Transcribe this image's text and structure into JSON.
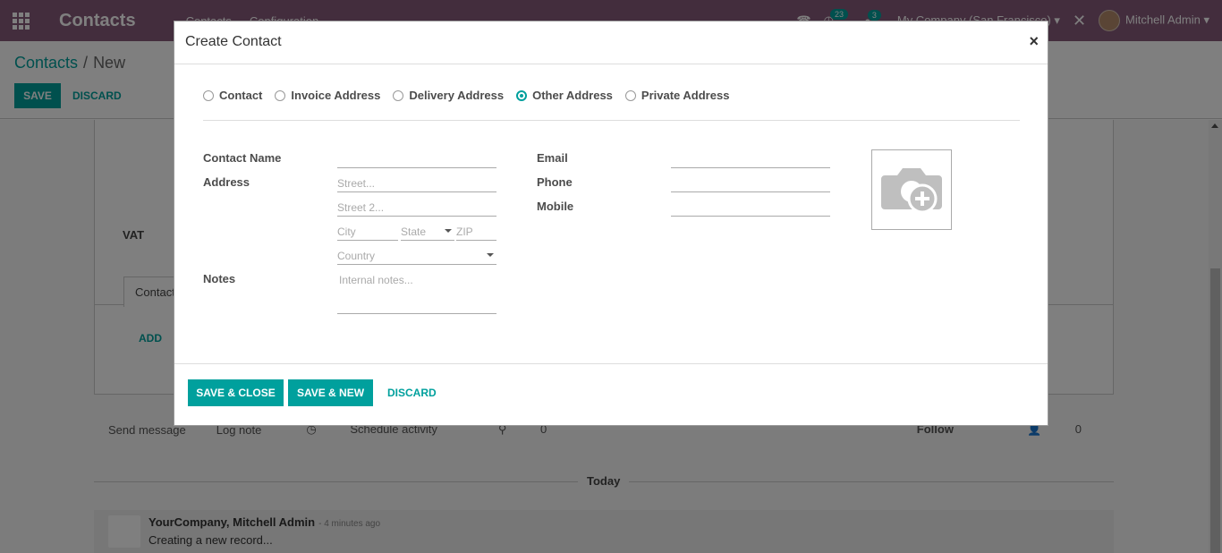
{
  "navbar": {
    "app_title": "Contacts",
    "menu": [
      "Contacts",
      "Configuration"
    ],
    "activity_count": "23",
    "message_count": "3",
    "company": "My Company (San Francisco)",
    "user": "Mitchell Admin"
  },
  "breadcrumb": {
    "parent": "Contacts",
    "current": "New"
  },
  "control": {
    "save_label": "SAVE",
    "discard_label": "DISCARD"
  },
  "background": {
    "vat_label": "VAT",
    "tab_label": "Contacts & Addresses",
    "add_label": "ADD",
    "chatter": {
      "send_message": "Send message",
      "log_note": "Log note",
      "schedule_activity": "Schedule activity",
      "attachments": "0",
      "follow": "Follow",
      "followers": "0"
    },
    "today_label": "Today",
    "message": {
      "author": "YourCompany, Mitchell Admin",
      "time": "- 4 minutes ago",
      "body": "Creating a new record..."
    }
  },
  "modal": {
    "title": "Create Contact",
    "close": "×",
    "address_types": [
      {
        "label": "Contact",
        "checked": false
      },
      {
        "label": "Invoice Address",
        "checked": false
      },
      {
        "label": "Delivery Address",
        "checked": false
      },
      {
        "label": "Other Address",
        "checked": true
      },
      {
        "label": "Private Address",
        "checked": false
      }
    ],
    "labels": {
      "contact_name": "Contact Name",
      "address": "Address",
      "notes": "Notes",
      "email": "Email",
      "phone": "Phone",
      "mobile": "Mobile"
    },
    "placeholders": {
      "street": "Street...",
      "street2": "Street 2...",
      "city": "City",
      "state": "State",
      "zip": "ZIP",
      "country": "Country",
      "notes": "Internal notes..."
    },
    "footer": {
      "save_close": "SAVE & CLOSE",
      "save_new": "SAVE & NEW",
      "discard": "DISCARD"
    }
  }
}
